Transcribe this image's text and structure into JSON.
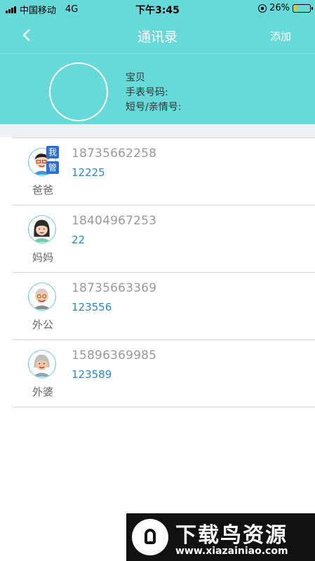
{
  "status_bar": {
    "carrier": "中国移动",
    "network": "4G",
    "time": "下午3:45",
    "battery": "26%",
    "battery_level": 0.26,
    "battery_color": "#f5c400"
  },
  "nav": {
    "back_icon": "chevron-left-icon",
    "title": "通讯录",
    "add_label": "添加",
    "accent": "#68d9d9"
  },
  "profile": {
    "name": "宝贝",
    "watch_number_label": "手表号码:",
    "short_number_label": "短号/亲情号:"
  },
  "contacts": [
    {
      "name": "爸爸",
      "phone": "18735662258",
      "short": "12225",
      "badges": [
        "我",
        "管"
      ],
      "avatar": "dad-avatar-icon"
    },
    {
      "name": "妈妈",
      "phone": "18404967253",
      "short": "22",
      "badges": [],
      "avatar": "mom-avatar-icon"
    },
    {
      "name": "外公",
      "phone": "18735663369",
      "short": "123556",
      "badges": [],
      "avatar": "grandpa-avatar-icon"
    },
    {
      "name": "外婆",
      "phone": "15896369985",
      "short": "123589",
      "badges": [],
      "avatar": "grandma-avatar-icon"
    }
  ],
  "watermark": {
    "title": "下载鸟资源",
    "url": "www.xiazainiao.com"
  }
}
